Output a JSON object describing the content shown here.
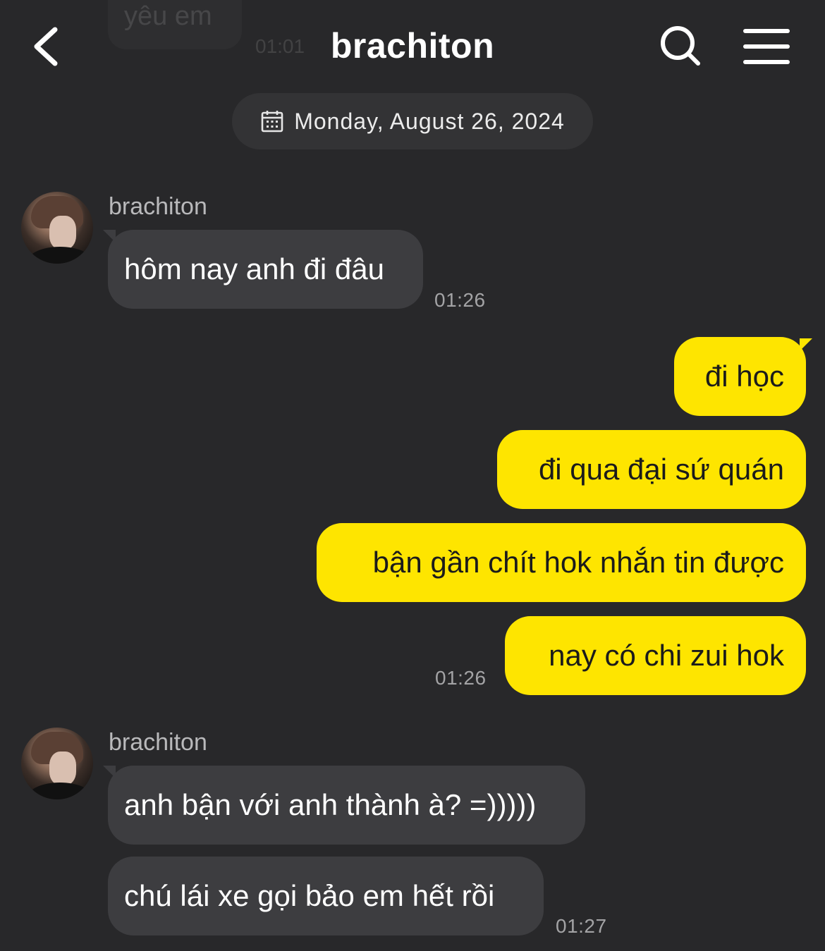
{
  "header": {
    "title": "brachiton",
    "back_icon": "chevron-left-icon",
    "search_icon": "search-icon",
    "menu_icon": "hamburger-menu-icon"
  },
  "previous_message": {
    "text": "yêu em",
    "time": "01:01"
  },
  "date_divider": {
    "icon": "calendar-icon",
    "text": "Monday, August 26, 2024"
  },
  "colors": {
    "background": "#28282a",
    "incoming_bubble": "#3d3d40",
    "outgoing_bubble": "#fee500",
    "date_pill": "#333335"
  },
  "messages": [
    {
      "direction": "incoming",
      "sender": "brachiton",
      "items": [
        {
          "text": "hôm nay anh đi đâu"
        }
      ],
      "time": "01:26"
    },
    {
      "direction": "outgoing",
      "items": [
        {
          "text": "đi học"
        },
        {
          "text": "đi qua đại sứ quán"
        },
        {
          "text": "bận gần chít hok nhắn tin được"
        },
        {
          "text": "nay có chi zui hok"
        }
      ],
      "time": "01:26"
    },
    {
      "direction": "incoming",
      "sender": "brachiton",
      "items": [
        {
          "text": "anh bận với anh thành à? =)))))"
        },
        {
          "text": "chú lái xe gọi bảo em hết rồi"
        }
      ],
      "time": "01:27"
    }
  ]
}
